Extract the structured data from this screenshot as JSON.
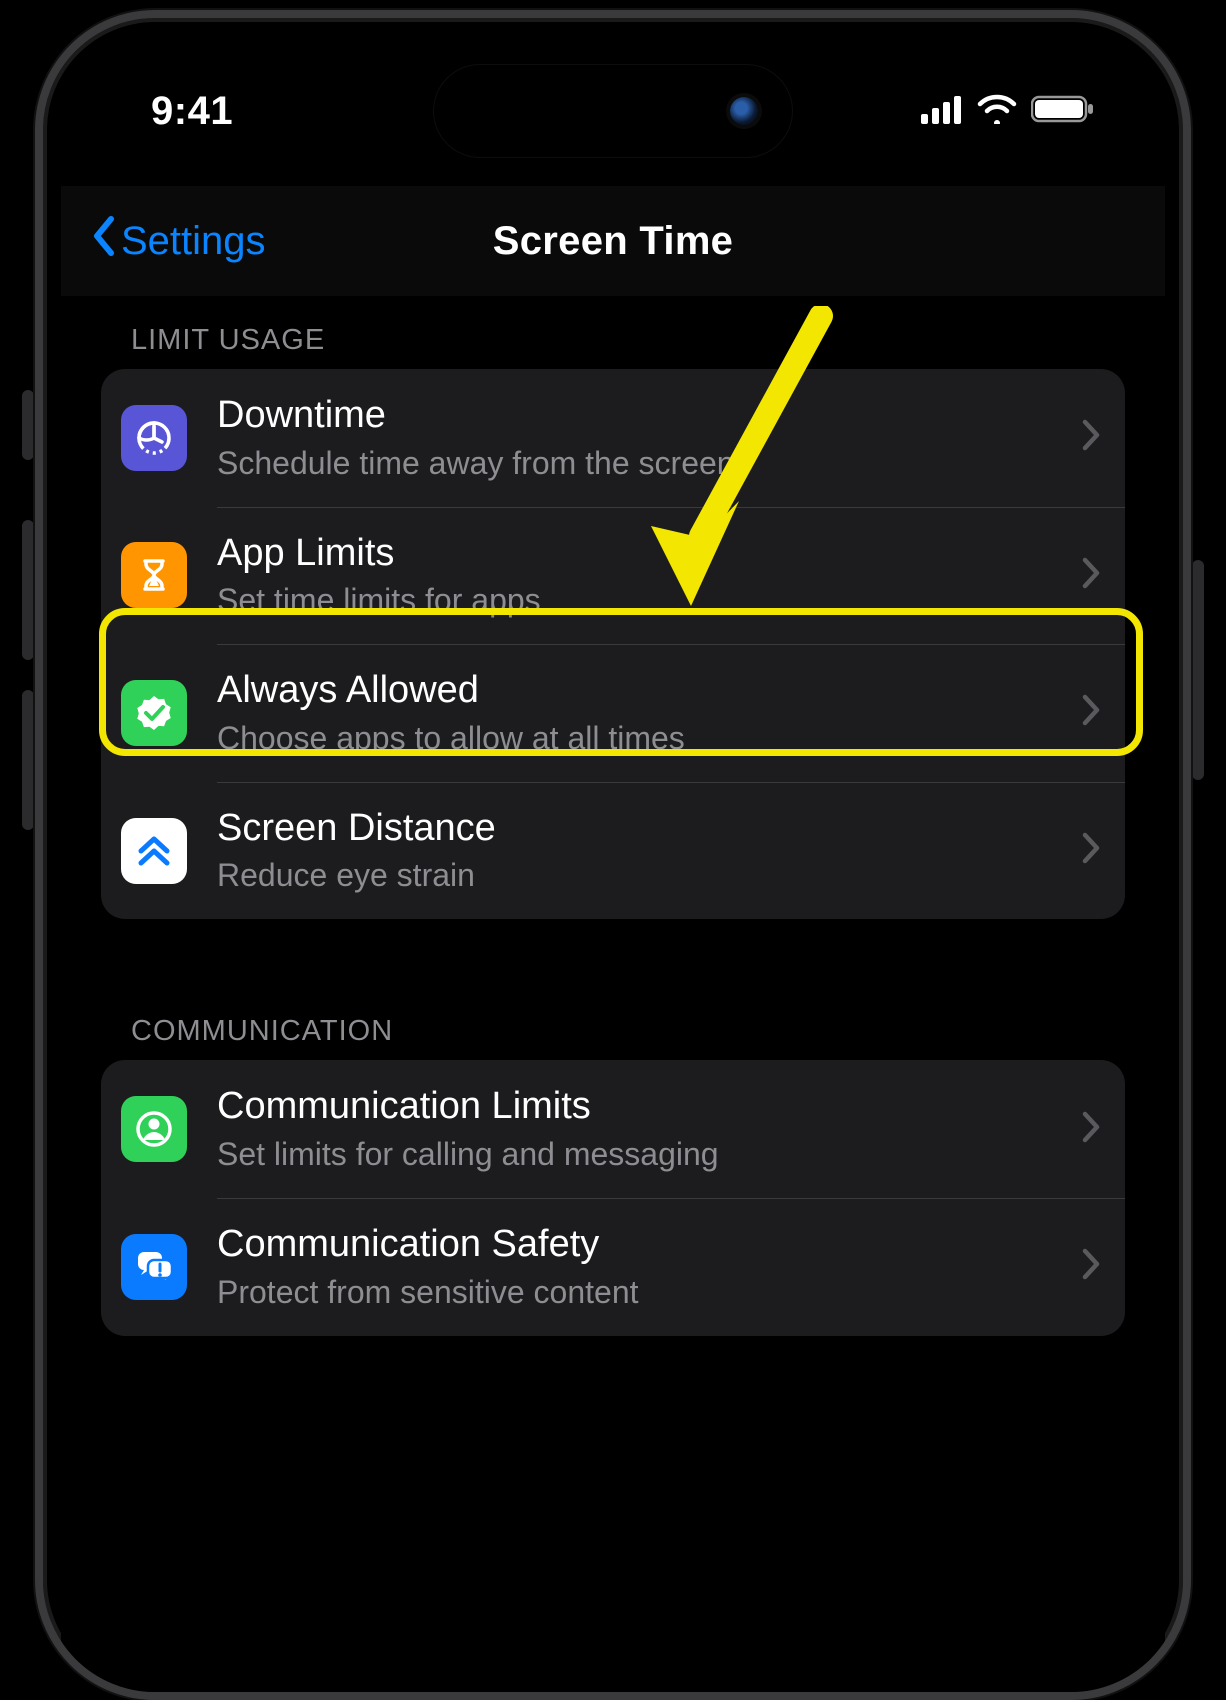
{
  "status": {
    "time": "9:41"
  },
  "nav": {
    "back_label": "Settings",
    "title": "Screen Time"
  },
  "sections": {
    "limit_usage": {
      "header": "LIMIT USAGE",
      "rows": {
        "downtime": {
          "title": "Downtime",
          "subtitle": "Schedule time away from the screen"
        },
        "app_limits": {
          "title": "App Limits",
          "subtitle": "Set time limits for apps"
        },
        "always_allowed": {
          "title": "Always Allowed",
          "subtitle": "Choose apps to allow at all times"
        },
        "screen_distance": {
          "title": "Screen Distance",
          "subtitle": "Reduce eye strain"
        }
      }
    },
    "communication": {
      "header": "COMMUNICATION",
      "rows": {
        "comm_limits": {
          "title": "Communication Limits",
          "subtitle": "Set limits for calling and messaging"
        },
        "comm_safety": {
          "title": "Communication Safety",
          "subtitle": "Protect from sensitive content"
        }
      }
    }
  },
  "annotation": {
    "highlight_row": "always_allowed",
    "colors": {
      "highlight": "#f3e600",
      "accent": "#0a84ff"
    }
  }
}
